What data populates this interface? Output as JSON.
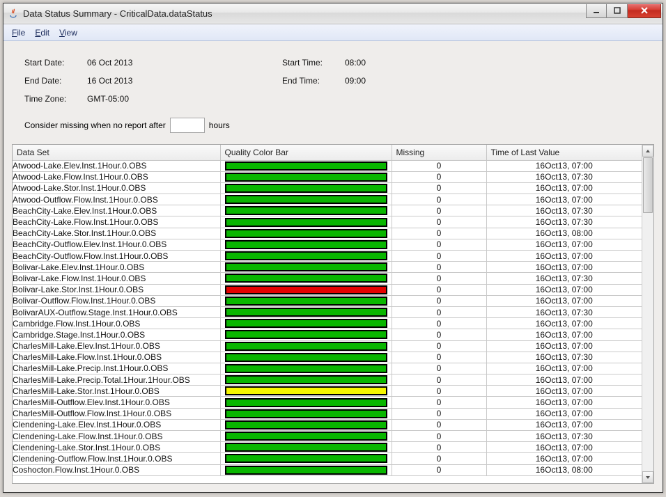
{
  "window": {
    "title": "Data Status Summary - CriticalData.dataStatus"
  },
  "menu": {
    "file": {
      "label": "File",
      "underline_index": 0
    },
    "edit": {
      "label": "Edit",
      "underline_index": 0
    },
    "view": {
      "label": "View",
      "underline_index": 0
    }
  },
  "form": {
    "start_date_label": "Start Date:",
    "start_date_value": "06 Oct 2013",
    "start_time_label": "Start Time:",
    "start_time_value": "08:00",
    "end_date_label": "End Date:",
    "end_date_value": "16 Oct 2013",
    "end_time_label": "End Time:",
    "end_time_value": "09:00",
    "time_zone_label": "Time Zone:",
    "time_zone_value": "GMT-05:00",
    "consider_prefix": "Consider missing when no report after",
    "consider_value": "",
    "consider_suffix": "hours"
  },
  "table": {
    "headers": {
      "dataset": "Data Set",
      "bar": "Quality Color Bar",
      "missing": "Missing",
      "time": "Time of Last Value"
    },
    "rows": [
      {
        "dataset": "Atwood-Lake.Elev.Inst.1Hour.0.OBS",
        "color": "green",
        "missing": "0",
        "time": "16Oct13, 07:00"
      },
      {
        "dataset": "Atwood-Lake.Flow.Inst.1Hour.0.OBS",
        "color": "green",
        "missing": "0",
        "time": "16Oct13, 07:30"
      },
      {
        "dataset": "Atwood-Lake.Stor.Inst.1Hour.0.OBS",
        "color": "green",
        "missing": "0",
        "time": "16Oct13, 07:00"
      },
      {
        "dataset": "Atwood-Outflow.Flow.Inst.1Hour.0.OBS",
        "color": "green",
        "missing": "0",
        "time": "16Oct13, 07:00"
      },
      {
        "dataset": "BeachCity-Lake.Elev.Inst.1Hour.0.OBS",
        "color": "green",
        "missing": "0",
        "time": "16Oct13, 07:30"
      },
      {
        "dataset": "BeachCity-Lake.Flow.Inst.1Hour.0.OBS",
        "color": "green",
        "missing": "0",
        "time": "16Oct13, 07:30"
      },
      {
        "dataset": "BeachCity-Lake.Stor.Inst.1Hour.0.OBS",
        "color": "green",
        "missing": "0",
        "time": "16Oct13, 08:00"
      },
      {
        "dataset": "BeachCity-Outflow.Elev.Inst.1Hour.0.OBS",
        "color": "green",
        "missing": "0",
        "time": "16Oct13, 07:00"
      },
      {
        "dataset": "BeachCity-Outflow.Flow.Inst.1Hour.0.OBS",
        "color": "green",
        "missing": "0",
        "time": "16Oct13, 07:00"
      },
      {
        "dataset": "Bolivar-Lake.Elev.Inst.1Hour.0.OBS",
        "color": "green",
        "missing": "0",
        "time": "16Oct13, 07:00"
      },
      {
        "dataset": "Bolivar-Lake.Flow.Inst.1Hour.0.OBS",
        "color": "green",
        "missing": "0",
        "time": "16Oct13, 07:30"
      },
      {
        "dataset": "Bolivar-Lake.Stor.Inst.1Hour.0.OBS",
        "color": "red",
        "missing": "0",
        "time": "16Oct13, 07:00"
      },
      {
        "dataset": "Bolivar-Outflow.Flow.Inst.1Hour.0.OBS",
        "color": "green",
        "missing": "0",
        "time": "16Oct13, 07:00"
      },
      {
        "dataset": "BolivarAUX-Outflow.Stage.Inst.1Hour.0.OBS",
        "color": "green",
        "missing": "0",
        "time": "16Oct13, 07:30"
      },
      {
        "dataset": "Cambridge.Flow.Inst.1Hour.0.OBS",
        "color": "green",
        "missing": "0",
        "time": "16Oct13, 07:00"
      },
      {
        "dataset": "Cambridge.Stage.Inst.1Hour.0.OBS",
        "color": "green",
        "missing": "0",
        "time": "16Oct13, 07:00"
      },
      {
        "dataset": "CharlesMill-Lake.Elev.Inst.1Hour.0.OBS",
        "color": "green",
        "missing": "0",
        "time": "16Oct13, 07:00"
      },
      {
        "dataset": "CharlesMill-Lake.Flow.Inst.1Hour.0.OBS",
        "color": "green",
        "missing": "0",
        "time": "16Oct13, 07:30"
      },
      {
        "dataset": "CharlesMill-Lake.Precip.Inst.1Hour.0.OBS",
        "color": "green",
        "missing": "0",
        "time": "16Oct13, 07:00"
      },
      {
        "dataset": "CharlesMill-Lake.Precip.Total.1Hour.1Hour.OBS",
        "color": "green",
        "missing": "0",
        "time": "16Oct13, 07:00"
      },
      {
        "dataset": "CharlesMill-Lake.Stor.Inst.1Hour.0.OBS",
        "color": "yellow",
        "missing": "0",
        "time": "16Oct13, 07:00"
      },
      {
        "dataset": "CharlesMill-Outflow.Elev.Inst.1Hour.0.OBS",
        "color": "green",
        "missing": "0",
        "time": "16Oct13, 07:00"
      },
      {
        "dataset": "CharlesMill-Outflow.Flow.Inst.1Hour.0.OBS",
        "color": "green",
        "missing": "0",
        "time": "16Oct13, 07:00"
      },
      {
        "dataset": "Clendening-Lake.Elev.Inst.1Hour.0.OBS",
        "color": "green",
        "missing": "0",
        "time": "16Oct13, 07:00"
      },
      {
        "dataset": "Clendening-Lake.Flow.Inst.1Hour.0.OBS",
        "color": "green",
        "missing": "0",
        "time": "16Oct13, 07:30"
      },
      {
        "dataset": "Clendening-Lake.Stor.Inst.1Hour.0.OBS",
        "color": "green",
        "missing": "0",
        "time": "16Oct13, 07:00"
      },
      {
        "dataset": "Clendening-Outflow.Flow.Inst.1Hour.0.OBS",
        "color": "green",
        "missing": "0",
        "time": "16Oct13, 07:00"
      },
      {
        "dataset": "Coshocton.Flow.Inst.1Hour.0.OBS",
        "color": "green",
        "missing": "0",
        "time": "16Oct13, 08:00"
      }
    ]
  }
}
